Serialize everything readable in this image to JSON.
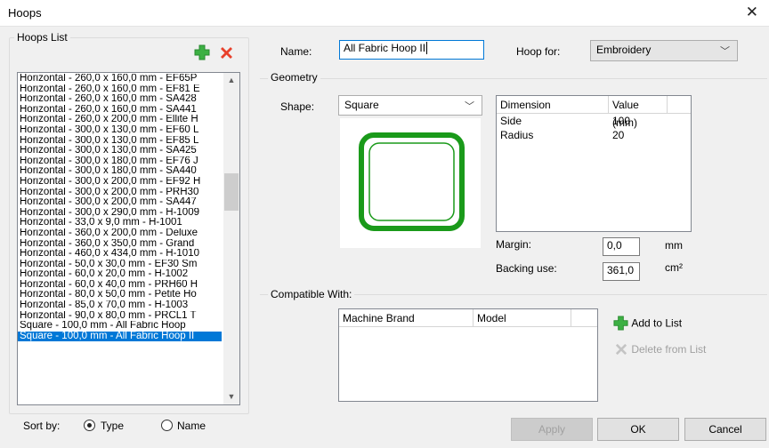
{
  "window": {
    "title": "Hoops"
  },
  "hoops_list": {
    "label": "Hoops List",
    "items": [
      "Horizontal - 260,0 x 160,0 mm - EF65P",
      "Horizontal - 260,0 x 160,0 mm - EF81 E",
      "Horizontal - 260,0 x 160,0 mm - SA428",
      "Horizontal - 260,0 x 160,0 mm - SA441",
      "Horizontal - 260,0 x 200,0 mm - Ellite H",
      "Horizontal - 300,0 x 130,0 mm - EF60 L",
      "Horizontal - 300,0 x 130,0 mm - EF85 L",
      "Horizontal - 300,0 x 130,0 mm - SA425",
      "Horizontal - 300,0 x 180,0 mm - EF76 J",
      "Horizontal - 300,0 x 180,0 mm - SA440",
      "Horizontal - 300,0 x 200,0 mm - EF92 H",
      "Horizontal - 300,0 x 200,0 mm - PRH30",
      "Horizontal - 300,0 x 200,0 mm - SA447",
      "Horizontal - 300,0 x 290,0 mm - H-1009",
      "Horizontal - 33,0 x 9,0 mm - H-1001",
      "Horizontal - 360,0 x 200,0 mm - Deluxe",
      "Horizontal - 360,0 x 350,0 mm - Grand",
      "Horizontal - 460,0 x 434,0 mm - H-1010",
      "Horizontal - 50,0 x 30,0 mm - EF30 Sm",
      "Horizontal - 60,0 x 20,0 mm - H-1002",
      "Horizontal - 60,0 x 40,0 mm - PRH60 H",
      "Horizontal - 80,0 x 50,0 mm - Petite Ho",
      "Horizontal - 85,0 x 70,0 mm - H-1003",
      "Horizontal - 90,0 x 80,0 mm - PRCL1 T",
      "Square - 100,0 mm - All Fabric Hoop",
      "Square - 100,0 mm - All Fabric Hoop II"
    ],
    "selected_index": 25,
    "sort_by_label": "Sort by:",
    "sort_options": [
      "Type",
      "Name"
    ],
    "sort_selected": "Type"
  },
  "details": {
    "name_label": "Name:",
    "name_value": "All Fabric Hoop II",
    "hoop_for_label": "Hoop for:",
    "hoop_for_value": "Embroidery"
  },
  "geometry": {
    "label": "Geometry",
    "shape_label": "Shape:",
    "shape_value": "Square",
    "table_headers": [
      "Dimension",
      "Value (mm)"
    ],
    "rows": [
      {
        "dimension": "Side",
        "value": "100"
      },
      {
        "dimension": "Radius",
        "value": "20"
      }
    ],
    "margin_label": "Margin:",
    "margin_value": "0,0",
    "margin_unit": "mm",
    "backing_label": "Backing use:",
    "backing_value": "361,0",
    "backing_unit": "cm²"
  },
  "compatible": {
    "label": "Compatible With:",
    "headers": [
      "Machine Brand",
      "Model"
    ],
    "add_label": "Add to List",
    "delete_label": "Delete from List"
  },
  "buttons": {
    "apply": "Apply",
    "ok": "OK",
    "cancel": "Cancel"
  },
  "colors": {
    "accent": "#0078d7",
    "hoop_green": "#1a9a1a",
    "add_green": "#3cb043",
    "delete_red": "#e8412c"
  }
}
